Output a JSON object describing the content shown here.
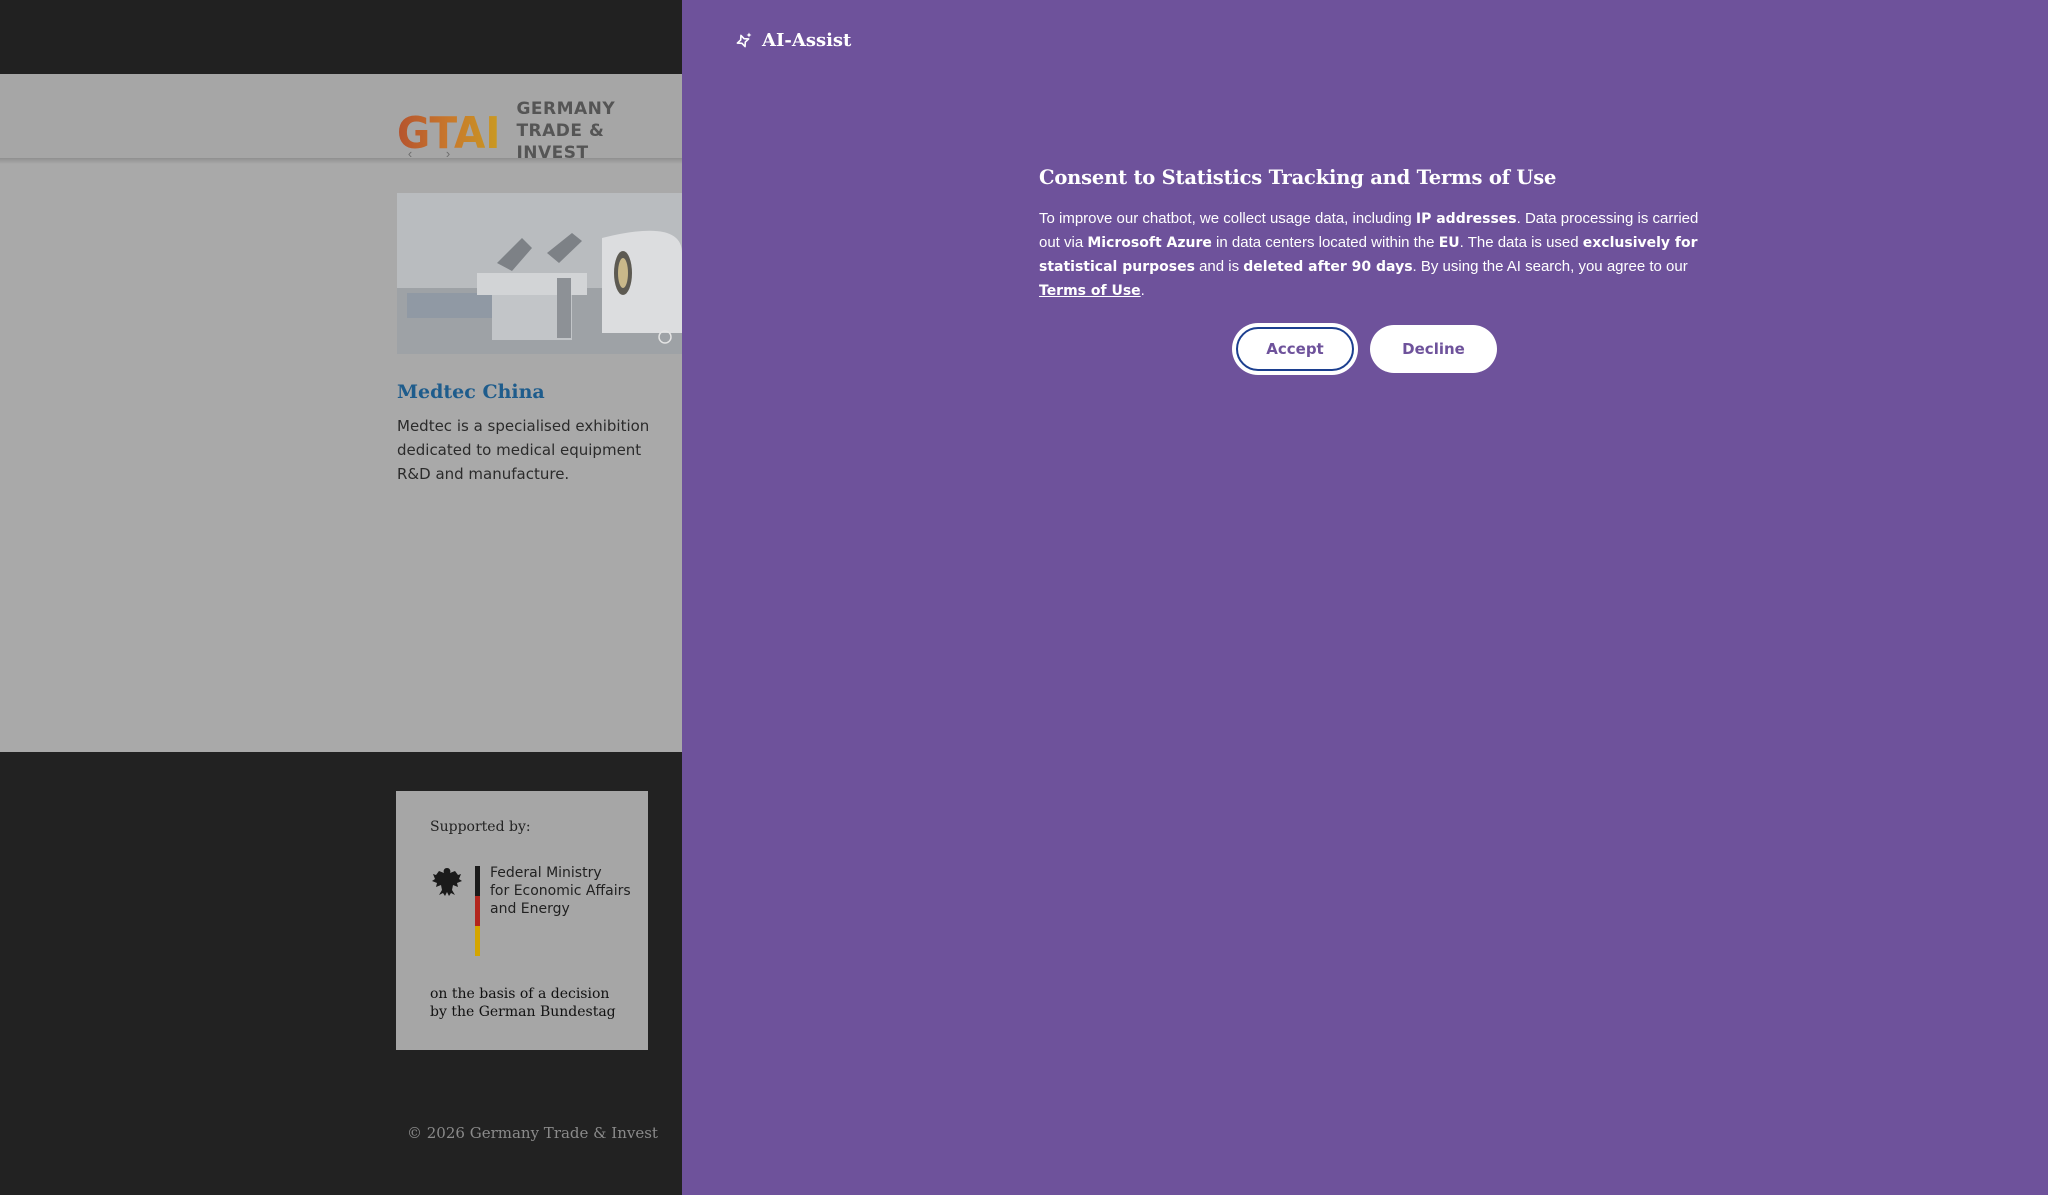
{
  "site": {
    "logo": {
      "mark": "GTAI",
      "line1": "GERMANY",
      "line2": "TRADE & INVEST"
    },
    "nav_arrows": {
      "prev": "‹",
      "next": "›"
    },
    "card": {
      "title": "Medtec China",
      "description": "Medtec is a specialised exhibition dedicated to medical equipment R&D and manufacture."
    },
    "footer": {
      "supported_by": "Supported by:",
      "ministry_line1": "Federal Ministry",
      "ministry_line2": "for Economic Affairs",
      "ministry_line3": "and Energy",
      "basis_line1": "on the basis of a decision",
      "basis_line2": "by the German Bundestag",
      "copyright": "© 2026 Germany Trade & Invest"
    }
  },
  "panel": {
    "title": "AI-Assist",
    "icon": "sparkle-icon",
    "background_color": "#6e529b",
    "consent": {
      "heading": "Consent to Statistics Tracking and Terms of Use",
      "text_1": "To improve our chatbot, we collect usage data, including ",
      "bold_1": "IP addresses",
      "text_2": ". Data processing is carried out via ",
      "bold_2": "Microsoft Azure",
      "text_3": " in data centers located within the ",
      "bold_3": "EU",
      "text_4": ". The data is used ",
      "bold_4": "exclusively for statistical purposes",
      "text_5": " and is ",
      "bold_5": "deleted after 90 days",
      "text_6": ". By using the AI search, you agree to our ",
      "link": "Terms of Use",
      "text_7": "."
    },
    "accept_label": "Accept",
    "decline_label": "Decline"
  }
}
